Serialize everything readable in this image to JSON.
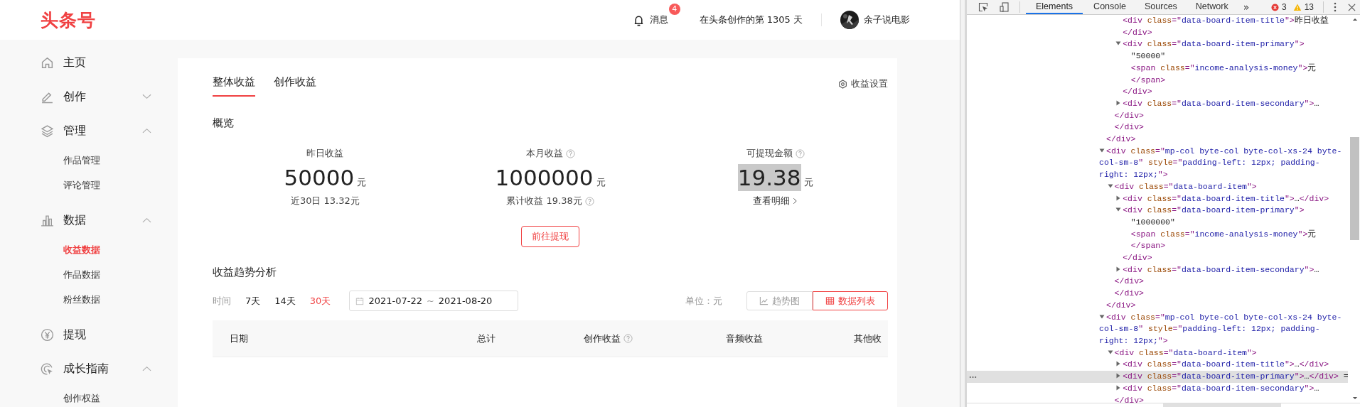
{
  "header": {
    "logo": "头条号",
    "messages": {
      "label": "消息",
      "badge": "4"
    },
    "days_text": "在头条创作的第 1305 天",
    "user": {
      "name": "余子说电影"
    }
  },
  "sidebar": {
    "items": [
      {
        "label": "主页"
      },
      {
        "label": "创作",
        "expanded": false
      },
      {
        "label": "管理",
        "expanded": true,
        "children": [
          {
            "label": "作品管理",
            "selected": false
          },
          {
            "label": "评论管理",
            "selected": false
          }
        ]
      },
      {
        "label": "数据",
        "expanded": true,
        "children": [
          {
            "label": "收益数据",
            "selected": true
          },
          {
            "label": "作品数据",
            "selected": false
          },
          {
            "label": "粉丝数据",
            "selected": false
          }
        ]
      },
      {
        "label": "提现"
      },
      {
        "label": "成长指南",
        "expanded": true,
        "children": [
          {
            "label": "创作权益",
            "selected": false
          }
        ]
      }
    ]
  },
  "tabs": [
    {
      "label": "整体收益",
      "selected": true
    },
    {
      "label": "创作收益",
      "selected": false
    }
  ],
  "settings_link": "收益设置",
  "overview": {
    "title": "概览",
    "stats": [
      {
        "title": "昨日收益",
        "help": false,
        "value": "50000",
        "unit": "元",
        "secondary": {
          "kind": "note",
          "text": "近30日 13.32元",
          "help": false
        },
        "highlighted": false
      },
      {
        "title": "本月收益",
        "help": true,
        "value": "1000000",
        "unit": "元",
        "secondary": {
          "kind": "note",
          "text": "累计收益 19.38元",
          "help": true
        },
        "highlighted": false
      },
      {
        "title": "可提现金额",
        "help": true,
        "value": "19.38",
        "unit": "元",
        "secondary": {
          "kind": "link",
          "text": "查看明细",
          "help": false
        },
        "highlighted": true
      }
    ],
    "withdraw_button": "前往提现"
  },
  "trend": {
    "title": "收益趋势分析",
    "time_label": "时间",
    "ranges": [
      {
        "label": "7天",
        "selected": false
      },
      {
        "label": "14天",
        "selected": false
      },
      {
        "label": "30天",
        "selected": true
      }
    ],
    "date_range": {
      "start": "2021-07-22",
      "separator": "~",
      "end": "2021-08-20"
    },
    "unit": "单位：元",
    "views": [
      {
        "label": "趋势图",
        "selected": false
      },
      {
        "label": "数据列表",
        "selected": true
      }
    ],
    "columns": [
      {
        "label": "日期",
        "help": false
      },
      {
        "label": "总计",
        "help": false
      },
      {
        "label": "创作收益",
        "help": true
      },
      {
        "label": "音频收益",
        "help": false
      },
      {
        "label": "其他收",
        "help": false
      }
    ]
  },
  "devtools": {
    "tabs": [
      {
        "label": "Elements",
        "selected": true
      },
      {
        "label": "Console",
        "selected": false
      },
      {
        "label": "Sources",
        "selected": false
      },
      {
        "label": "Network",
        "selected": false
      }
    ],
    "more": "»",
    "errors": "3",
    "warnings": "13",
    "tree": [
      {
        "children": [
          {
            "children": [
              {
                "selected": false,
                "tokens": [
                  {
                    "kind": "tag",
                    "text": "<div"
                  },
                  {
                    "kind": "attr",
                    "text": " class"
                  },
                  {
                    "kind": "tag",
                    "text": "=\""
                  },
                  {
                    "kind": "val",
                    "text": "data-board-item-title"
                  },
                  {
                    "kind": "tag",
                    "text": "\">"
                  },
                  {
                    "kind": "txt",
                    "text": "昨日收益"
                  }
                ]
              },
              {
                "selected": false,
                "tokens": [
                  {
                    "kind": "tag",
                    "text": "</div>"
                  }
                ]
              },
              {
                "selected": false,
                "expanded": true,
                "tokens": [
                  {
                    "kind": "tag",
                    "text": "<div"
                  },
                  {
                    "kind": "attr",
                    "text": " class"
                  },
                  {
                    "kind": "tag",
                    "text": "=\""
                  },
                  {
                    "kind": "val",
                    "text": "data-board-item-primary"
                  },
                  {
                    "kind": "tag",
                    "text": "\">"
                  }
                ],
                "children": [
                  {
                    "selected": false,
                    "tokens": [
                      {
                        "kind": "txt",
                        "text": "\"50000\""
                      }
                    ]
                  },
                  {
                    "selected": false,
                    "tokens": [
                      {
                        "kind": "tag",
                        "text": "<span"
                      },
                      {
                        "kind": "attr",
                        "text": " class"
                      },
                      {
                        "kind": "tag",
                        "text": "=\""
                      },
                      {
                        "kind": "val",
                        "text": "income-analysis-money"
                      },
                      {
                        "kind": "tag",
                        "text": "\">"
                      },
                      {
                        "kind": "txt",
                        "text": "元"
                      }
                    ]
                  },
                  {
                    "selected": false,
                    "tokens": [
                      {
                        "kind": "tag",
                        "text": "</span>"
                      }
                    ]
                  }
                ]
              },
              {
                "selected": false,
                "tokens": [
                  {
                    "kind": "tag",
                    "text": "</div>"
                  }
                ]
              },
              {
                "selected": false,
                "expanded": false,
                "tokens": [
                  {
                    "kind": "tag",
                    "text": "<div"
                  },
                  {
                    "kind": "attr",
                    "text": " class"
                  },
                  {
                    "kind": "tag",
                    "text": "=\""
                  },
                  {
                    "kind": "val",
                    "text": "data-board-item-secondary"
                  },
                  {
                    "kind": "tag",
                    "text": "\">"
                  },
                  {
                    "kind": "txt",
                    "text": "…"
                  }
                ]
              }
            ]
          },
          {
            "selected": false,
            "tokens": [
              {
                "kind": "tag",
                "text": "</div>"
              }
            ]
          },
          {
            "selected": false,
            "tokens": [
              {
                "kind": "tag",
                "text": "</div>"
              }
            ]
          }
        ]
      },
      {
        "selected": false,
        "tokens": [
          {
            "kind": "tag",
            "text": "</div>"
          }
        ]
      },
      {
        "selected": false,
        "expanded": true,
        "tokens": [
          {
            "kind": "tag",
            "text": "<div"
          },
          {
            "kind": "attr",
            "text": " class"
          },
          {
            "kind": "tag",
            "text": "=\""
          },
          {
            "kind": "val",
            "text": "mp-col byte-col byte-col-xs-24 byte-col-sm-8"
          },
          {
            "kind": "tag",
            "text": "\""
          },
          {
            "kind": "attr",
            "text": " style"
          },
          {
            "kind": "tag",
            "text": "=\""
          },
          {
            "kind": "val",
            "text": "padding-left: 12px; padding-right: 12px;"
          },
          {
            "kind": "tag",
            "text": "\">"
          }
        ],
        "children": [
          {
            "selected": false,
            "expanded": true,
            "tokens": [
              {
                "kind": "tag",
                "text": "<div"
              },
              {
                "kind": "attr",
                "text": " class"
              },
              {
                "kind": "tag",
                "text": "=\""
              },
              {
                "kind": "val",
                "text": "data-board-item"
              },
              {
                "kind": "tag",
                "text": "\">"
              }
            ],
            "children": [
              {
                "selected": false,
                "expanded": false,
                "tokens": [
                  {
                    "kind": "tag",
                    "text": "<div"
                  },
                  {
                    "kind": "attr",
                    "text": " class"
                  },
                  {
                    "kind": "tag",
                    "text": "=\""
                  },
                  {
                    "kind": "val",
                    "text": "data-board-item-title"
                  },
                  {
                    "kind": "tag",
                    "text": "\">"
                  },
                  {
                    "kind": "txt",
                    "text": "…"
                  },
                  {
                    "kind": "tag",
                    "text": "</div>"
                  }
                ]
              },
              {
                "selected": false,
                "expanded": true,
                "tokens": [
                  {
                    "kind": "tag",
                    "text": "<div"
                  },
                  {
                    "kind": "attr",
                    "text": " class"
                  },
                  {
                    "kind": "tag",
                    "text": "=\""
                  },
                  {
                    "kind": "val",
                    "text": "data-board-item-primary"
                  },
                  {
                    "kind": "tag",
                    "text": "\">"
                  }
                ],
                "children": [
                  {
                    "selected": false,
                    "tokens": [
                      {
                        "kind": "txt",
                        "text": "\"1000000\""
                      }
                    ]
                  },
                  {
                    "selected": false,
                    "tokens": [
                      {
                        "kind": "tag",
                        "text": "<span"
                      },
                      {
                        "kind": "attr",
                        "text": " class"
                      },
                      {
                        "kind": "tag",
                        "text": "=\""
                      },
                      {
                        "kind": "val",
                        "text": "income-analysis-money"
                      },
                      {
                        "kind": "tag",
                        "text": "\">"
                      },
                      {
                        "kind": "txt",
                        "text": "元"
                      }
                    ]
                  },
                  {
                    "selected": false,
                    "tokens": [
                      {
                        "kind": "tag",
                        "text": "</span>"
                      }
                    ]
                  }
                ]
              },
              {
                "selected": false,
                "tokens": [
                  {
                    "kind": "tag",
                    "text": "</div>"
                  }
                ]
              },
              {
                "selected": false,
                "expanded": false,
                "tokens": [
                  {
                    "kind": "tag",
                    "text": "<div"
                  },
                  {
                    "kind": "attr",
                    "text": " class"
                  },
                  {
                    "kind": "tag",
                    "text": "=\""
                  },
                  {
                    "kind": "val",
                    "text": "data-board-item-secondary"
                  },
                  {
                    "kind": "tag",
                    "text": "\">"
                  },
                  {
                    "kind": "txt",
                    "text": "…"
                  }
                ]
              }
            ]
          },
          {
            "selected": false,
            "tokens": [
              {
                "kind": "tag",
                "text": "</div>"
              }
            ]
          },
          {
            "selected": false,
            "tokens": [
              {
                "kind": "tag",
                "text": "</div>"
              }
            ]
          }
        ]
      },
      {
        "selected": false,
        "tokens": [
          {
            "kind": "tag",
            "text": "</div>"
          }
        ]
      },
      {
        "selected": false,
        "expanded": true,
        "tokens": [
          {
            "kind": "tag",
            "text": "<div"
          },
          {
            "kind": "attr",
            "text": " class"
          },
          {
            "kind": "tag",
            "text": "=\""
          },
          {
            "kind": "val",
            "text": "mp-col byte-col byte-col-xs-24 byte-col-sm-8"
          },
          {
            "kind": "tag",
            "text": "\""
          },
          {
            "kind": "attr",
            "text": " style"
          },
          {
            "kind": "tag",
            "text": "=\""
          },
          {
            "kind": "val",
            "text": "padding-left: 12px; padding-right: 12px;"
          },
          {
            "kind": "tag",
            "text": "\">"
          }
        ],
        "children": [
          {
            "selected": false,
            "expanded": true,
            "tokens": [
              {
                "kind": "tag",
                "text": "<div"
              },
              {
                "kind": "attr",
                "text": " class"
              },
              {
                "kind": "tag",
                "text": "=\""
              },
              {
                "kind": "val",
                "text": "data-board-item"
              },
              {
                "kind": "tag",
                "text": "\">"
              }
            ],
            "children": [
              {
                "selected": false,
                "expanded": false,
                "tokens": [
                  {
                    "kind": "tag",
                    "text": "<div"
                  },
                  {
                    "kind": "attr",
                    "text": " class"
                  },
                  {
                    "kind": "tag",
                    "text": "=\""
                  },
                  {
                    "kind": "val",
                    "text": "data-board-item-title"
                  },
                  {
                    "kind": "tag",
                    "text": "\">"
                  },
                  {
                    "kind": "txt",
                    "text": "…"
                  },
                  {
                    "kind": "tag",
                    "text": "</div>"
                  }
                ]
              },
              {
                "selected": true,
                "expanded": false,
                "tokens": [
                  {
                    "kind": "tag",
                    "text": "<div"
                  },
                  {
                    "kind": "attr",
                    "text": " class"
                  },
                  {
                    "kind": "tag",
                    "text": "=\""
                  },
                  {
                    "kind": "val",
                    "text": "data-board-item-primary"
                  },
                  {
                    "kind": "tag",
                    "text": "\">"
                  },
                  {
                    "kind": "txt",
                    "text": "…"
                  },
                  {
                    "kind": "tag",
                    "text": "</div>"
                  },
                  {
                    "kind": "txt",
                    "text": " ="
                  }
                ]
              },
              {
                "selected": false,
                "expanded": false,
                "tokens": [
                  {
                    "kind": "tag",
                    "text": "<div"
                  },
                  {
                    "kind": "attr",
                    "text": " class"
                  },
                  {
                    "kind": "tag",
                    "text": "=\""
                  },
                  {
                    "kind": "val",
                    "text": "data-board-item-secondary"
                  },
                  {
                    "kind": "tag",
                    "text": "\">"
                  },
                  {
                    "kind": "txt",
                    "text": "…"
                  }
                ]
              }
            ]
          },
          {
            "selected": false,
            "tokens": [
              {
                "kind": "tag",
                "text": "</div>"
              }
            ]
          }
        ]
      }
    ]
  }
}
